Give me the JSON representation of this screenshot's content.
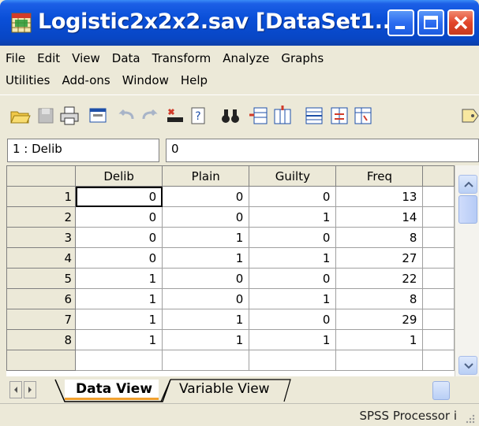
{
  "window": {
    "title": "Logistic2x2x2.sav [DataSet1..."
  },
  "menu": {
    "row1": [
      {
        "label": "File"
      },
      {
        "label": "Edit"
      },
      {
        "label": "View"
      },
      {
        "label": "Data"
      },
      {
        "label": "Transform"
      },
      {
        "label": "Analyze"
      },
      {
        "label": "Graphs"
      }
    ],
    "row2": [
      {
        "label": "Utilities"
      },
      {
        "label": "Add-ons"
      },
      {
        "label": "Window"
      },
      {
        "label": "Help"
      }
    ]
  },
  "cell_editor": {
    "reference": "1 : Delib",
    "value": "0"
  },
  "grid": {
    "columns": [
      "Delib",
      "Plain",
      "Guilty",
      "Freq"
    ],
    "rows": [
      {
        "num": "1",
        "cells": [
          "0",
          "0",
          "0",
          "13"
        ]
      },
      {
        "num": "2",
        "cells": [
          "0",
          "0",
          "1",
          "14"
        ]
      },
      {
        "num": "3",
        "cells": [
          "0",
          "1",
          "0",
          "8"
        ]
      },
      {
        "num": "4",
        "cells": [
          "0",
          "1",
          "1",
          "27"
        ]
      },
      {
        "num": "5",
        "cells": [
          "1",
          "0",
          "0",
          "22"
        ]
      },
      {
        "num": "6",
        "cells": [
          "1",
          "0",
          "1",
          "8"
        ]
      },
      {
        "num": "7",
        "cells": [
          "1",
          "1",
          "0",
          "29"
        ]
      },
      {
        "num": "8",
        "cells": [
          "1",
          "1",
          "1",
          "1"
        ]
      }
    ]
  },
  "tabs": {
    "data_view": "Data View",
    "variable_view": "Variable View"
  },
  "status": {
    "text": "SPSS Processor i"
  },
  "colors": {
    "title_bar": "#0a4fd8",
    "grid_header": "#ece9d8",
    "tab_accent": "#f0a030"
  }
}
